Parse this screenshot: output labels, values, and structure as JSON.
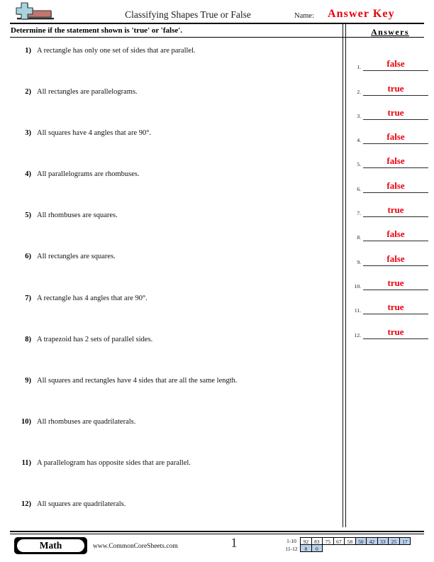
{
  "header": {
    "title": "Classifying Shapes True or False",
    "name_label": "Name:",
    "name_value": "Answer Key",
    "logo_icon": "plus-block-logo"
  },
  "instruction": "Determine if the statement shown is 'true' or 'false'.",
  "questions": [
    {
      "num": "1)",
      "text": "A rectangle has only one set of sides that are parallel."
    },
    {
      "num": "2)",
      "text": "All rectangles are parallelograms."
    },
    {
      "num": "3)",
      "text": "All squares have 4 angles that are 90°."
    },
    {
      "num": "4)",
      "text": "All parallelograms are rhombuses."
    },
    {
      "num": "5)",
      "text": "All rhombuses are squares."
    },
    {
      "num": "6)",
      "text": "All rectangles are squares."
    },
    {
      "num": "7)",
      "text": "A rectangle has 4 angles that are 90°."
    },
    {
      "num": "8)",
      "text": "A trapezoid has 2 sets of parallel sides."
    },
    {
      "num": "9)",
      "text": "All squares and rectangles have 4 sides that are all the same length."
    },
    {
      "num": "10)",
      "text": "All rhombuses are quadrilaterals."
    },
    {
      "num": "11)",
      "text": "A parallelogram has opposite sides that are parallel."
    },
    {
      "num": "12)",
      "text": "All squares are quadrilaterals."
    }
  ],
  "answers": {
    "heading": "Answers",
    "items": [
      {
        "num": "1.",
        "value": "false"
      },
      {
        "num": "2.",
        "value": "true"
      },
      {
        "num": "3.",
        "value": "true"
      },
      {
        "num": "4.",
        "value": "false"
      },
      {
        "num": "5.",
        "value": "false"
      },
      {
        "num": "6.",
        "value": "false"
      },
      {
        "num": "7.",
        "value": "true"
      },
      {
        "num": "8.",
        "value": "false"
      },
      {
        "num": "9.",
        "value": "false"
      },
      {
        "num": "10.",
        "value": "true"
      },
      {
        "num": "11.",
        "value": "true"
      },
      {
        "num": "12.",
        "value": "true"
      }
    ]
  },
  "footer": {
    "subject_badge": "Math",
    "site_url": "www.CommonCoreSheets.com",
    "page_number": "1",
    "score_table": {
      "rows": [
        {
          "label": "1-10",
          "cells": [
            {
              "value": "92",
              "highlighted": false
            },
            {
              "value": "83",
              "highlighted": false
            },
            {
              "value": "75",
              "highlighted": false
            },
            {
              "value": "67",
              "highlighted": false
            },
            {
              "value": "58",
              "highlighted": false
            },
            {
              "value": "50",
              "highlighted": true
            },
            {
              "value": "42",
              "highlighted": true
            },
            {
              "value": "33",
              "highlighted": true
            },
            {
              "value": "25",
              "highlighted": true
            },
            {
              "value": "17",
              "highlighted": true
            }
          ]
        },
        {
          "label": "11-12",
          "cells": [
            {
              "value": "8",
              "highlighted": true
            },
            {
              "value": "0",
              "highlighted": true
            }
          ]
        }
      ]
    }
  },
  "colors": {
    "answer_red": "#e8000d",
    "highlight_blue": "#bcd2ee",
    "logo_blue": "#a8d5dd",
    "logo_red": "#c4766e"
  }
}
